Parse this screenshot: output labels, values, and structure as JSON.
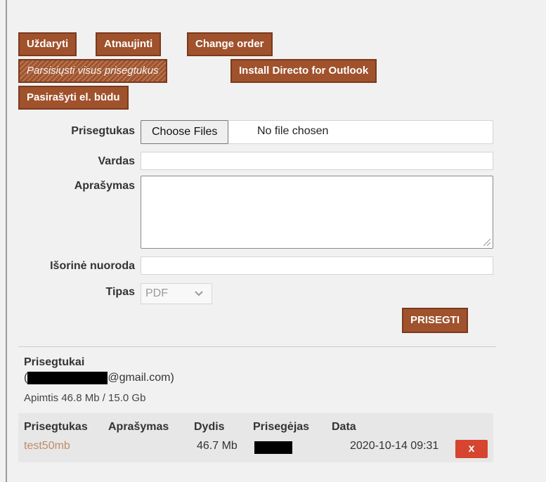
{
  "toolbar": {
    "close_label": "Uždaryti",
    "refresh_label": "Atnaujinti",
    "change_order_label": "Change order",
    "download_all_label": "Parsisiųsti visus prisegtukus",
    "install_outlook_label": "Install Directo for Outlook",
    "sign_label": "Pasirašyti el. būdu"
  },
  "form": {
    "attachment_label": "Prisegtukas",
    "choose_files_label": "Choose Files",
    "no_file_text": "No file chosen",
    "name_label": "Vardas",
    "name_value": "",
    "description_label": "Aprašymas",
    "description_value": "",
    "external_link_label": "Išorinė nuoroda",
    "external_link_value": "",
    "type_label": "Tipas",
    "type_selected": "PDF",
    "submit_label": "PRISEGTI"
  },
  "attachments": {
    "title": "Prisegtukai",
    "email_suffix": "@gmail.com)",
    "email_prefix": "(",
    "usage": "Apimtis 46.8 Mb / 15.0 Gb",
    "columns": [
      "Prisegtukas",
      "Aprašymas",
      "Dydis",
      "Prisegėjas",
      "Data"
    ],
    "rows": [
      {
        "file": "test50mb",
        "description": "",
        "size": "46.7 Mb",
        "uploader": "",
        "date": "2020-10-14 09:31",
        "delete_label": "x"
      }
    ]
  },
  "colors": {
    "button_brown": "#a0522d",
    "delete_red": "#d5452f",
    "link_tan": "#c08a6a"
  }
}
